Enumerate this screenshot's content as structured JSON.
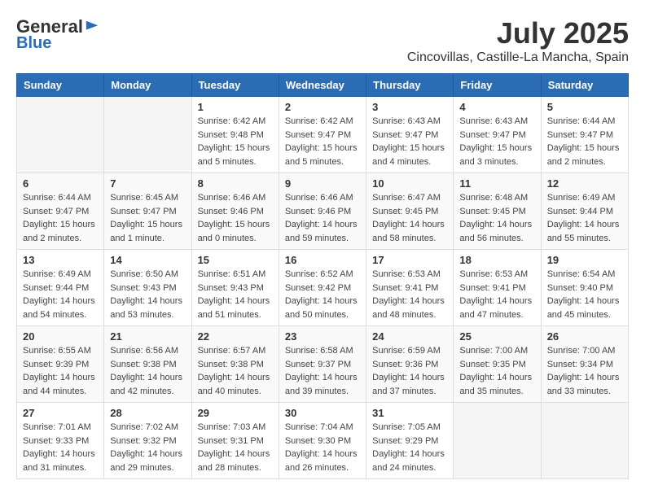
{
  "logo": {
    "general": "General",
    "blue": "Blue"
  },
  "title": "July 2025",
  "subtitle": "Cincovillas, Castille-La Mancha, Spain",
  "days_of_week": [
    "Sunday",
    "Monday",
    "Tuesday",
    "Wednesday",
    "Thursday",
    "Friday",
    "Saturday"
  ],
  "weeks": [
    [
      {
        "day": "",
        "sunrise": "",
        "sunset": "",
        "daylight": ""
      },
      {
        "day": "",
        "sunrise": "",
        "sunset": "",
        "daylight": ""
      },
      {
        "day": "1",
        "sunrise": "Sunrise: 6:42 AM",
        "sunset": "Sunset: 9:48 PM",
        "daylight": "Daylight: 15 hours and 5 minutes."
      },
      {
        "day": "2",
        "sunrise": "Sunrise: 6:42 AM",
        "sunset": "Sunset: 9:47 PM",
        "daylight": "Daylight: 15 hours and 5 minutes."
      },
      {
        "day": "3",
        "sunrise": "Sunrise: 6:43 AM",
        "sunset": "Sunset: 9:47 PM",
        "daylight": "Daylight: 15 hours and 4 minutes."
      },
      {
        "day": "4",
        "sunrise": "Sunrise: 6:43 AM",
        "sunset": "Sunset: 9:47 PM",
        "daylight": "Daylight: 15 hours and 3 minutes."
      },
      {
        "day": "5",
        "sunrise": "Sunrise: 6:44 AM",
        "sunset": "Sunset: 9:47 PM",
        "daylight": "Daylight: 15 hours and 2 minutes."
      }
    ],
    [
      {
        "day": "6",
        "sunrise": "Sunrise: 6:44 AM",
        "sunset": "Sunset: 9:47 PM",
        "daylight": "Daylight: 15 hours and 2 minutes."
      },
      {
        "day": "7",
        "sunrise": "Sunrise: 6:45 AM",
        "sunset": "Sunset: 9:47 PM",
        "daylight": "Daylight: 15 hours and 1 minute."
      },
      {
        "day": "8",
        "sunrise": "Sunrise: 6:46 AM",
        "sunset": "Sunset: 9:46 PM",
        "daylight": "Daylight: 15 hours and 0 minutes."
      },
      {
        "day": "9",
        "sunrise": "Sunrise: 6:46 AM",
        "sunset": "Sunset: 9:46 PM",
        "daylight": "Daylight: 14 hours and 59 minutes."
      },
      {
        "day": "10",
        "sunrise": "Sunrise: 6:47 AM",
        "sunset": "Sunset: 9:45 PM",
        "daylight": "Daylight: 14 hours and 58 minutes."
      },
      {
        "day": "11",
        "sunrise": "Sunrise: 6:48 AM",
        "sunset": "Sunset: 9:45 PM",
        "daylight": "Daylight: 14 hours and 56 minutes."
      },
      {
        "day": "12",
        "sunrise": "Sunrise: 6:49 AM",
        "sunset": "Sunset: 9:44 PM",
        "daylight": "Daylight: 14 hours and 55 minutes."
      }
    ],
    [
      {
        "day": "13",
        "sunrise": "Sunrise: 6:49 AM",
        "sunset": "Sunset: 9:44 PM",
        "daylight": "Daylight: 14 hours and 54 minutes."
      },
      {
        "day": "14",
        "sunrise": "Sunrise: 6:50 AM",
        "sunset": "Sunset: 9:43 PM",
        "daylight": "Daylight: 14 hours and 53 minutes."
      },
      {
        "day": "15",
        "sunrise": "Sunrise: 6:51 AM",
        "sunset": "Sunset: 9:43 PM",
        "daylight": "Daylight: 14 hours and 51 minutes."
      },
      {
        "day": "16",
        "sunrise": "Sunrise: 6:52 AM",
        "sunset": "Sunset: 9:42 PM",
        "daylight": "Daylight: 14 hours and 50 minutes."
      },
      {
        "day": "17",
        "sunrise": "Sunrise: 6:53 AM",
        "sunset": "Sunset: 9:41 PM",
        "daylight": "Daylight: 14 hours and 48 minutes."
      },
      {
        "day": "18",
        "sunrise": "Sunrise: 6:53 AM",
        "sunset": "Sunset: 9:41 PM",
        "daylight": "Daylight: 14 hours and 47 minutes."
      },
      {
        "day": "19",
        "sunrise": "Sunrise: 6:54 AM",
        "sunset": "Sunset: 9:40 PM",
        "daylight": "Daylight: 14 hours and 45 minutes."
      }
    ],
    [
      {
        "day": "20",
        "sunrise": "Sunrise: 6:55 AM",
        "sunset": "Sunset: 9:39 PM",
        "daylight": "Daylight: 14 hours and 44 minutes."
      },
      {
        "day": "21",
        "sunrise": "Sunrise: 6:56 AM",
        "sunset": "Sunset: 9:38 PM",
        "daylight": "Daylight: 14 hours and 42 minutes."
      },
      {
        "day": "22",
        "sunrise": "Sunrise: 6:57 AM",
        "sunset": "Sunset: 9:38 PM",
        "daylight": "Daylight: 14 hours and 40 minutes."
      },
      {
        "day": "23",
        "sunrise": "Sunrise: 6:58 AM",
        "sunset": "Sunset: 9:37 PM",
        "daylight": "Daylight: 14 hours and 39 minutes."
      },
      {
        "day": "24",
        "sunrise": "Sunrise: 6:59 AM",
        "sunset": "Sunset: 9:36 PM",
        "daylight": "Daylight: 14 hours and 37 minutes."
      },
      {
        "day": "25",
        "sunrise": "Sunrise: 7:00 AM",
        "sunset": "Sunset: 9:35 PM",
        "daylight": "Daylight: 14 hours and 35 minutes."
      },
      {
        "day": "26",
        "sunrise": "Sunrise: 7:00 AM",
        "sunset": "Sunset: 9:34 PM",
        "daylight": "Daylight: 14 hours and 33 minutes."
      }
    ],
    [
      {
        "day": "27",
        "sunrise": "Sunrise: 7:01 AM",
        "sunset": "Sunset: 9:33 PM",
        "daylight": "Daylight: 14 hours and 31 minutes."
      },
      {
        "day": "28",
        "sunrise": "Sunrise: 7:02 AM",
        "sunset": "Sunset: 9:32 PM",
        "daylight": "Daylight: 14 hours and 29 minutes."
      },
      {
        "day": "29",
        "sunrise": "Sunrise: 7:03 AM",
        "sunset": "Sunset: 9:31 PM",
        "daylight": "Daylight: 14 hours and 28 minutes."
      },
      {
        "day": "30",
        "sunrise": "Sunrise: 7:04 AM",
        "sunset": "Sunset: 9:30 PM",
        "daylight": "Daylight: 14 hours and 26 minutes."
      },
      {
        "day": "31",
        "sunrise": "Sunrise: 7:05 AM",
        "sunset": "Sunset: 9:29 PM",
        "daylight": "Daylight: 14 hours and 24 minutes."
      },
      {
        "day": "",
        "sunrise": "",
        "sunset": "",
        "daylight": ""
      },
      {
        "day": "",
        "sunrise": "",
        "sunset": "",
        "daylight": ""
      }
    ]
  ]
}
